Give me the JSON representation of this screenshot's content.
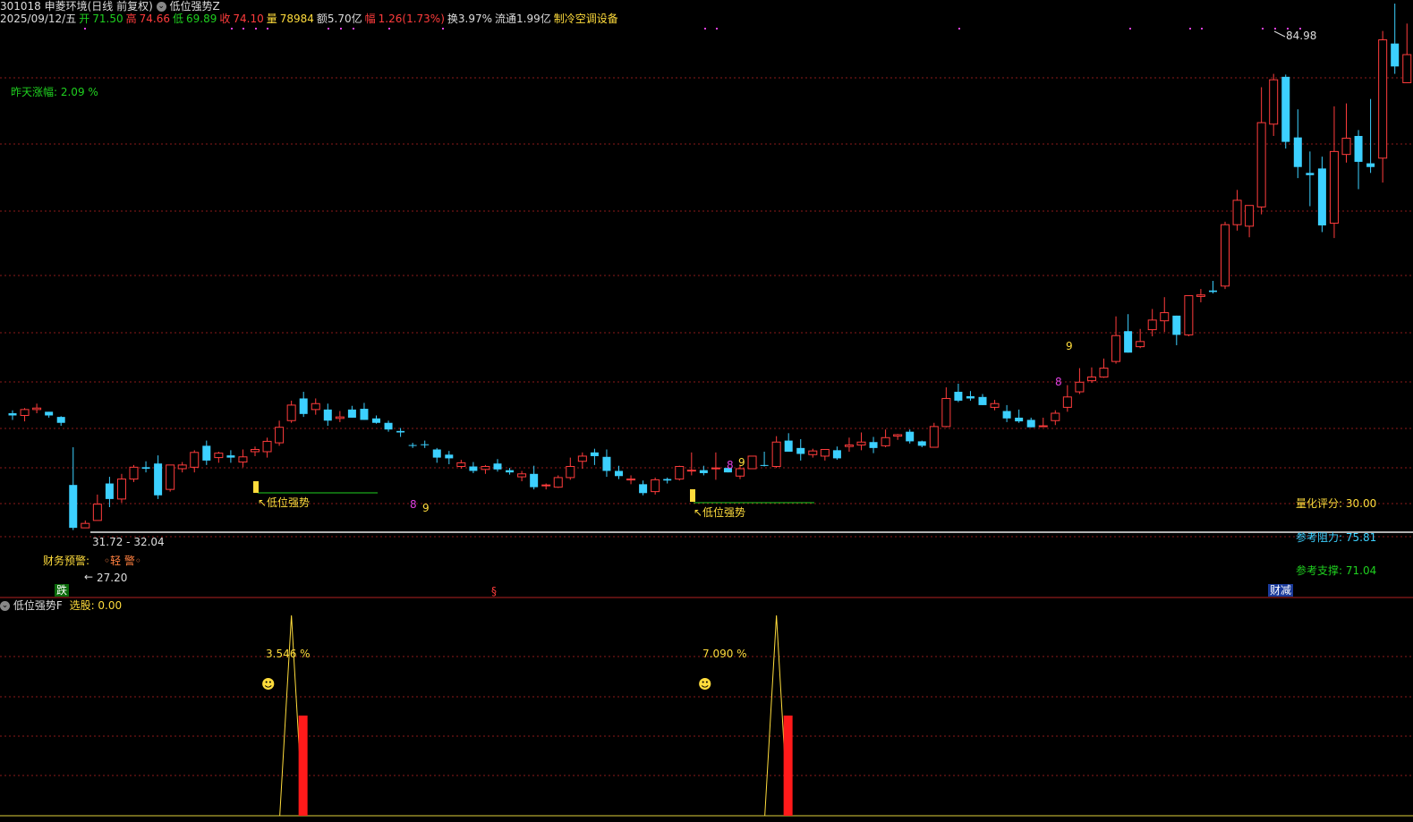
{
  "header": {
    "symbol": "301018 申菱环境(日线 前复权)",
    "indicator_main": "低位强势Z",
    "date": "2025/09/12/五",
    "open_label": "开",
    "open": "71.50",
    "high_label": "高",
    "high": "74.66",
    "low_label": "低",
    "low": "69.89",
    "close_label": "收",
    "close": "74.10",
    "vol_label": "量",
    "vol": "78984",
    "amt": "额5.70亿",
    "chg_label": "幅",
    "chg": "1.26(1.73%)",
    "turnover": "换3.97%",
    "float_cap": "流通1.99亿",
    "industry": "制冷空调设备"
  },
  "main_panel": {
    "yesterday_change": "昨天涨幅: 2.09 %",
    "high_mark": "84.98",
    "low_mark": "27.20",
    "range_label": "31.72 - 32.04",
    "finance_warn_label": "财务预警:",
    "finance_warn_value": "◦轻 警◦",
    "signal_1": "↖低位强势",
    "signal_2": "↖低位强势",
    "fall_badge": "跌",
    "section_mark": "§",
    "finance_cut_badge": "财减",
    "quant_score": "量化评分: 30.00",
    "resistance": "参考阻力: 75.81",
    "support": "参考支撑: 71.04",
    "count_labels": [
      {
        "t": "8",
        "c": "#e040e0"
      },
      {
        "t": "9",
        "c": "#ffdc3c"
      },
      {
        "t": "8",
        "c": "#e040e0"
      },
      {
        "t": "9",
        "c": "#ffdc3c"
      },
      {
        "t": "8",
        "c": "#e040e0"
      },
      {
        "t": "9",
        "c": "#ffdc3c"
      }
    ]
  },
  "sub_panel": {
    "title": "低位强势F",
    "select_label": "选股: 0.00",
    "peak_1": "3.546 %",
    "peak_2": "7.090 %",
    "smiley": "☻"
  },
  "colors": {
    "up": "#ff3c3c",
    "down": "#3cd0ff",
    "grid": "#8b1a1a",
    "signal": "#ffdc3c",
    "support_line": "#1fd01f"
  },
  "chart_data": {
    "type": "candlestick",
    "ohlc": [
      [
        47.5,
        47.9,
        46.6,
        47.2
      ],
      [
        47.2,
        48.2,
        46.4,
        48.0
      ],
      [
        48.0,
        48.8,
        47.5,
        48.2
      ],
      [
        47.7,
        47.7,
        46.9,
        47.2
      ],
      [
        47.0,
        47.1,
        45.8,
        46.2
      ],
      [
        37.8,
        42.9,
        31.7,
        32.0
      ],
      [
        32.0,
        33.0,
        32.0,
        32.6
      ],
      [
        33.0,
        36.5,
        33.0,
        35.2
      ],
      [
        38.0,
        38.9,
        34.8,
        35.9
      ],
      [
        35.9,
        39.3,
        35.4,
        38.6
      ],
      [
        38.6,
        40.5,
        38.2,
        40.2
      ],
      [
        40.2,
        41.0,
        39.5,
        40.0
      ],
      [
        40.7,
        41.8,
        35.9,
        36.4
      ],
      [
        37.2,
        40.5,
        36.9,
        40.5
      ],
      [
        40.0,
        40.9,
        39.5,
        40.5
      ],
      [
        40.2,
        42.5,
        39.5,
        42.2
      ],
      [
        43.1,
        43.8,
        40.5,
        41.1
      ],
      [
        41.5,
        42.3,
        40.8,
        42.1
      ],
      [
        41.8,
        42.5,
        40.8,
        41.5
      ],
      [
        40.9,
        42.6,
        40.2,
        41.6
      ],
      [
        42.3,
        43.0,
        41.7,
        42.6
      ],
      [
        42.3,
        44.2,
        41.5,
        43.7
      ],
      [
        43.5,
        46.5,
        43.1,
        45.6
      ],
      [
        46.5,
        49.2,
        46.2,
        48.6
      ],
      [
        49.5,
        50.4,
        47.0,
        47.4
      ],
      [
        48.0,
        49.5,
        47.3,
        48.8
      ],
      [
        48.0,
        48.8,
        45.8,
        46.5
      ],
      [
        46.8,
        47.8,
        46.3,
        47.0
      ],
      [
        48.0,
        48.5,
        46.9,
        46.9
      ],
      [
        48.1,
        48.9,
        46.6,
        46.6
      ],
      [
        46.8,
        47.2,
        46.1,
        46.2
      ],
      [
        46.2,
        46.5,
        45.0,
        45.3
      ],
      [
        45.1,
        45.5,
        44.3,
        44.9
      ],
      [
        43.2,
        43.5,
        42.8,
        43.1
      ],
      [
        43.3,
        43.8,
        42.8,
        43.2
      ],
      [
        42.6,
        42.8,
        40.8,
        41.5
      ],
      [
        41.9,
        42.4,
        40.6,
        41.4
      ],
      [
        40.3,
        41.2,
        40.0,
        40.8
      ],
      [
        40.3,
        40.9,
        39.4,
        39.7
      ],
      [
        39.9,
        40.5,
        39.3,
        40.3
      ],
      [
        40.7,
        41.3,
        39.6,
        39.9
      ],
      [
        39.8,
        40.1,
        39.2,
        39.5
      ],
      [
        38.9,
        39.7,
        38.3,
        39.3
      ],
      [
        39.3,
        40.4,
        37.2,
        37.5
      ],
      [
        37.7,
        38.0,
        37.2,
        37.8
      ],
      [
        37.5,
        39.1,
        37.4,
        38.8
      ],
      [
        38.8,
        41.5,
        38.5,
        40.3
      ],
      [
        41.0,
        42.2,
        40.0,
        41.7
      ],
      [
        42.2,
        42.7,
        40.5,
        41.7
      ],
      [
        41.6,
        42.6,
        38.9,
        39.7
      ],
      [
        39.7,
        40.4,
        38.6,
        39.0
      ],
      [
        38.5,
        39.1,
        37.9,
        38.6
      ],
      [
        37.9,
        38.4,
        36.4,
        36.7
      ],
      [
        36.9,
        38.8,
        36.5,
        38.5
      ],
      [
        38.6,
        38.8,
        38.0,
        38.4
      ],
      [
        38.6,
        40.4,
        38.4,
        40.3
      ],
      [
        39.8,
        42.2,
        39.1,
        39.8
      ],
      [
        39.8,
        40.4,
        39.1,
        39.4
      ],
      [
        40.0,
        42.2,
        38.5,
        40.1
      ],
      [
        40.1,
        40.2,
        39.8,
        39.5
      ],
      [
        39.0,
        40.5,
        38.6,
        40.0
      ],
      [
        40.0,
        41.5,
        40.0,
        41.7
      ],
      [
        40.5,
        42.3,
        40.3,
        40.4
      ],
      [
        40.3,
        44.4,
        40.1,
        43.6
      ],
      [
        43.8,
        44.8,
        43.5,
        42.3
      ],
      [
        42.8,
        44.0,
        41.1,
        42.0
      ],
      [
        41.9,
        42.7,
        41.5,
        42.4
      ],
      [
        41.7,
        42.4,
        41.1,
        42.6
      ],
      [
        42.5,
        43.0,
        41.2,
        41.4
      ],
      [
        43.0,
        44.2,
        42.3,
        43.2
      ],
      [
        43.2,
        44.9,
        42.5,
        43.6
      ],
      [
        43.6,
        44.3,
        42.1,
        42.8
      ],
      [
        43.1,
        45.3,
        42.9,
        44.2
      ],
      [
        44.4,
        44.7,
        43.9,
        44.6
      ],
      [
        45.0,
        45.3,
        43.4,
        43.7
      ],
      [
        43.7,
        43.8,
        42.9,
        43.1
      ],
      [
        42.9,
        46.2,
        42.9,
        45.7
      ],
      [
        45.7,
        51.0,
        45.6,
        49.5
      ],
      [
        50.4,
        51.5,
        49.0,
        49.2
      ],
      [
        49.8,
        50.5,
        49.2,
        49.5
      ],
      [
        49.7,
        50.1,
        48.7,
        48.6
      ],
      [
        48.3,
        49.3,
        47.9,
        48.8
      ],
      [
        47.8,
        48.6,
        46.3,
        46.8
      ],
      [
        46.9,
        48.0,
        46.2,
        46.4
      ],
      [
        46.6,
        46.9,
        45.6,
        45.6
      ],
      [
        45.8,
        46.9,
        45.7,
        45.8
      ],
      [
        46.5,
        47.9,
        45.9,
        47.5
      ],
      [
        48.3,
        51.3,
        47.7,
        49.7
      ],
      [
        50.4,
        53.6,
        50.1,
        51.7
      ],
      [
        51.9,
        53.7,
        51.6,
        52.4
      ],
      [
        52.4,
        54.9,
        52.3,
        53.6
      ],
      [
        54.5,
        60.6,
        54.2,
        58.0
      ],
      [
        58.6,
        60.9,
        55.8,
        55.7
      ],
      [
        56.5,
        58.9,
        56.3,
        57.2
      ],
      [
        58.8,
        61.6,
        57.9,
        60.1
      ],
      [
        60.0,
        63.2,
        58.5,
        61.1
      ],
      [
        60.7,
        60.6,
        56.7,
        58.1
      ],
      [
        58.1,
        62.5,
        57.9,
        63.4
      ],
      [
        63.3,
        64.3,
        62.5,
        63.5
      ],
      [
        64.1,
        65.4,
        63.7,
        63.9
      ],
      [
        64.7,
        73.4,
        64.3,
        73.0
      ],
      [
        73.0,
        77.7,
        72.2,
        76.3
      ],
      [
        72.8,
        73.8,
        71.3,
        75.6
      ],
      [
        75.4,
        91.6,
        74.4,
        86.8
      ],
      [
        86.6,
        93.4,
        85.0,
        92.6
      ],
      [
        93.0,
        93.3,
        83.3,
        84.2
      ],
      [
        84.8,
        88.6,
        79.3,
        80.8
      ],
      [
        80.0,
        82.9,
        75.5,
        79.7
      ],
      [
        80.6,
        82.2,
        72.0,
        72.9
      ],
      [
        73.2,
        89.0,
        71.2,
        82.9
      ],
      [
        82.5,
        89.4,
        81.4,
        84.7
      ],
      [
        85.0,
        85.8,
        77.8,
        81.5
      ],
      [
        81.3,
        90.0,
        80.0,
        80.8
      ],
      [
        82.0,
        99.2,
        78.7,
        98.0
      ],
      [
        97.5,
        102.9,
        93.4,
        94.4
      ],
      [
        92.2,
        100.2,
        93.2,
        96.0
      ],
      [
        94.0,
        95.7,
        86.7,
        88.9
      ],
      [
        89.0,
        89.2,
        88.1,
        88.0
      ],
      [
        88.5,
        90.6,
        81.8,
        81.5
      ],
      [
        81.8,
        80.5,
        79.9,
        83.9
      ],
      [
        83.8,
        84.5,
        80.8,
        81.0
      ],
      [
        80.2,
        81.3,
        79.2,
        79.6
      ],
      [
        80.0,
        85.8,
        79.3,
        85.3
      ],
      [
        86.2,
        89.0,
        84.6,
        87.1
      ],
      [
        87.2,
        89.3,
        85.2,
        88.8
      ]
    ],
    "sub_peaks": [
      {
        "bar": 23,
        "value": 3.546
      },
      {
        "bar": 63,
        "value": 7.09
      }
    ]
  }
}
